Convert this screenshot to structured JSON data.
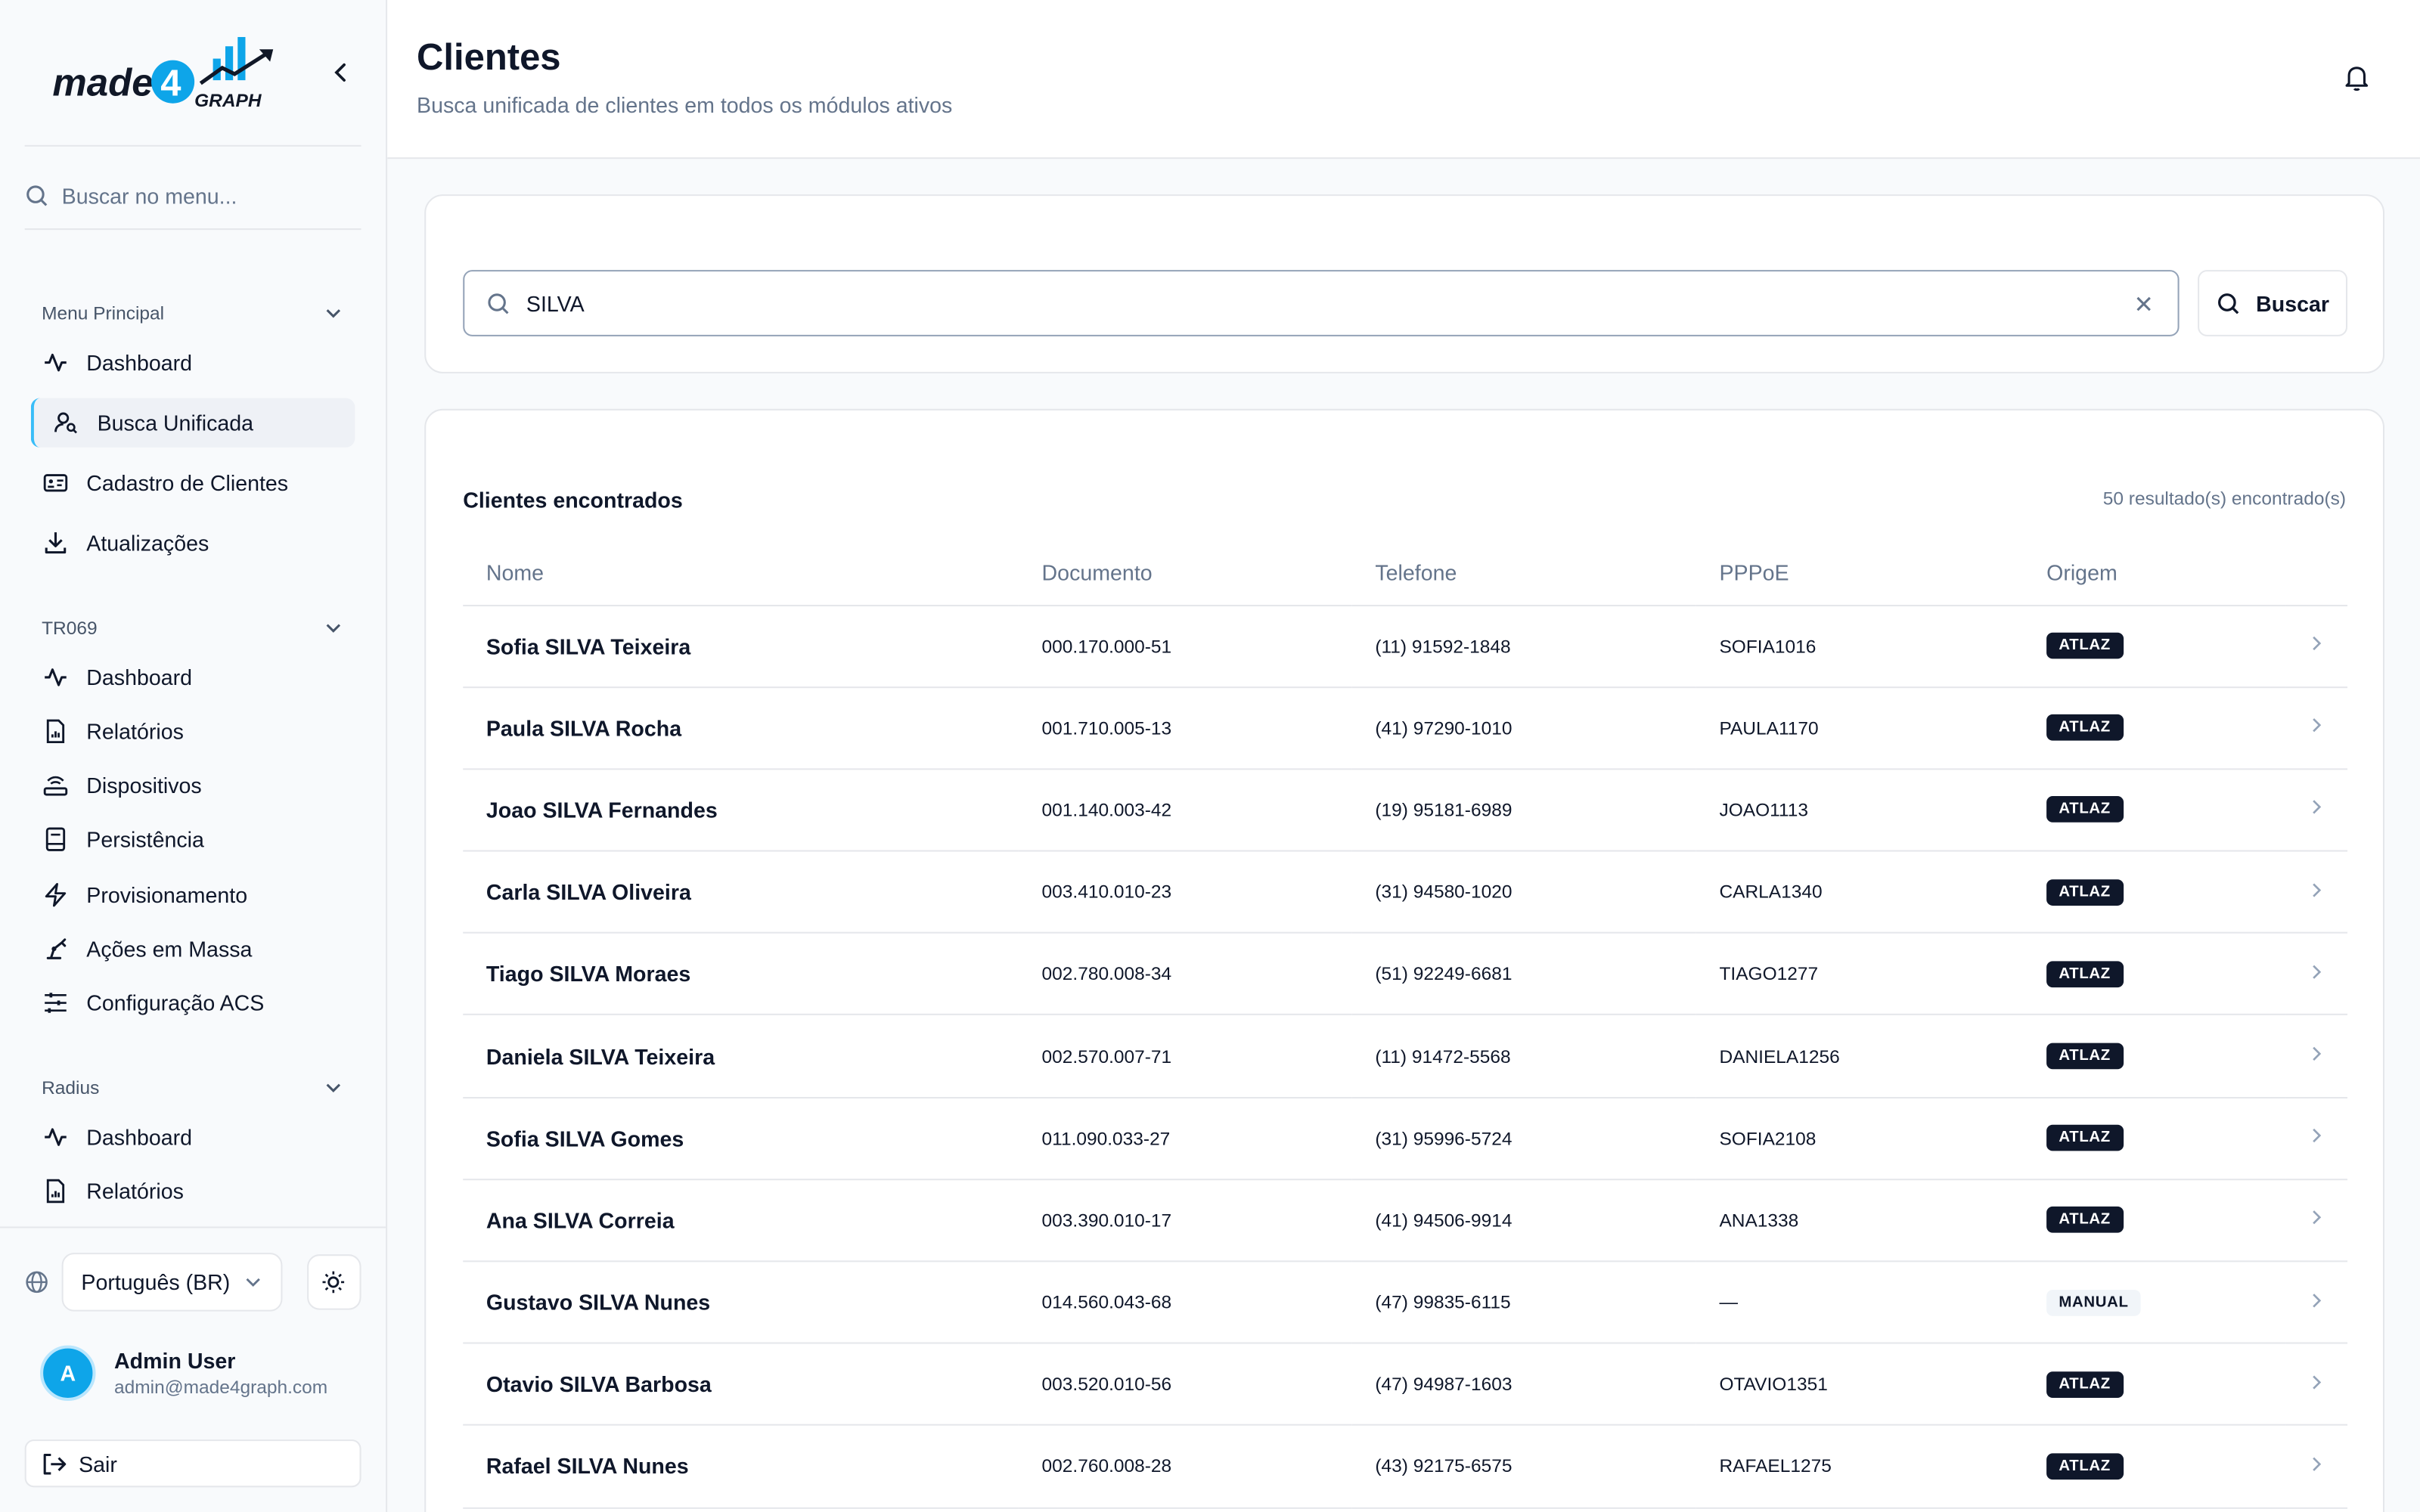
{
  "brand": {
    "logo_text_made": "made",
    "logo_text_4": "4",
    "logo_text_graph": "GRAPH"
  },
  "sidebar": {
    "search_placeholder": "Buscar no menu...",
    "sections": [
      {
        "title": "Menu Principal",
        "items": [
          "Dashboard",
          "Busca Unificada",
          "Cadastro de Clientes",
          "Atualizações"
        ]
      },
      {
        "title": "TR069",
        "items": [
          "Dashboard",
          "Relatórios",
          "Dispositivos",
          "Persistência",
          "Provisionamento",
          "Ações em Massa",
          "Configuração ACS"
        ]
      },
      {
        "title": "Radius",
        "items": [
          "Dashboard",
          "Relatórios"
        ]
      }
    ],
    "active_item": "Busca Unificada",
    "language": "Português (BR)",
    "user": {
      "initial": "A",
      "name": "Admin User",
      "email": "admin@made4graph.com"
    },
    "logout_label": "Sair"
  },
  "header": {
    "title": "Clientes",
    "subtitle": "Busca unificada de clientes em todos os módulos ativos"
  },
  "search": {
    "value": "SILVA",
    "button_label": "Buscar"
  },
  "results": {
    "title": "Clientes encontrados",
    "count_text": "50 resultado(s) encontrado(s)",
    "columns": [
      "Nome",
      "Documento",
      "Telefone",
      "PPPoE",
      "Origem"
    ],
    "rows": [
      {
        "nome": "Sofia SILVA Teixeira",
        "documento": "000.170.000-51",
        "telefone": "(11) 91592-1848",
        "pppoe": "SOFIA1016",
        "origem": "ATLAZ"
      },
      {
        "nome": "Paula SILVA Rocha",
        "documento": "001.710.005-13",
        "telefone": "(41) 97290-1010",
        "pppoe": "PAULA1170",
        "origem": "ATLAZ"
      },
      {
        "nome": "Joao SILVA Fernandes",
        "documento": "001.140.003-42",
        "telefone": "(19) 95181-6989",
        "pppoe": "JOAO1113",
        "origem": "ATLAZ"
      },
      {
        "nome": "Carla SILVA Oliveira",
        "documento": "003.410.010-23",
        "telefone": "(31) 94580-1020",
        "pppoe": "CARLA1340",
        "origem": "ATLAZ"
      },
      {
        "nome": "Tiago SILVA Moraes",
        "documento": "002.780.008-34",
        "telefone": "(51) 92249-6681",
        "pppoe": "TIAGO1277",
        "origem": "ATLAZ"
      },
      {
        "nome": "Daniela SILVA Teixeira",
        "documento": "002.570.007-71",
        "telefone": "(11) 91472-5568",
        "pppoe": "DANIELA1256",
        "origem": "ATLAZ"
      },
      {
        "nome": "Sofia SILVA Gomes",
        "documento": "011.090.033-27",
        "telefone": "(31) 95996-5724",
        "pppoe": "SOFIA2108",
        "origem": "ATLAZ"
      },
      {
        "nome": "Ana SILVA Correia",
        "documento": "003.390.010-17",
        "telefone": "(41) 94506-9914",
        "pppoe": "ANA1338",
        "origem": "ATLAZ"
      },
      {
        "nome": "Gustavo SILVA Nunes",
        "documento": "014.560.043-68",
        "telefone": "(47) 99835-6115",
        "pppoe": "—",
        "origem": "MANUAL"
      },
      {
        "nome": "Otavio SILVA Barbosa",
        "documento": "003.520.010-56",
        "telefone": "(47) 94987-1603",
        "pppoe": "OTAVIO1351",
        "origem": "ATLAZ"
      },
      {
        "nome": "Rafael SILVA Nunes",
        "documento": "002.760.008-28",
        "telefone": "(43) 92175-6575",
        "pppoe": "RAFAEL1275",
        "origem": "ATLAZ"
      }
    ]
  },
  "colors": {
    "accent": "#38bdf8",
    "badge_dark": "#0f172a",
    "avatar": "#0ea5e9"
  }
}
